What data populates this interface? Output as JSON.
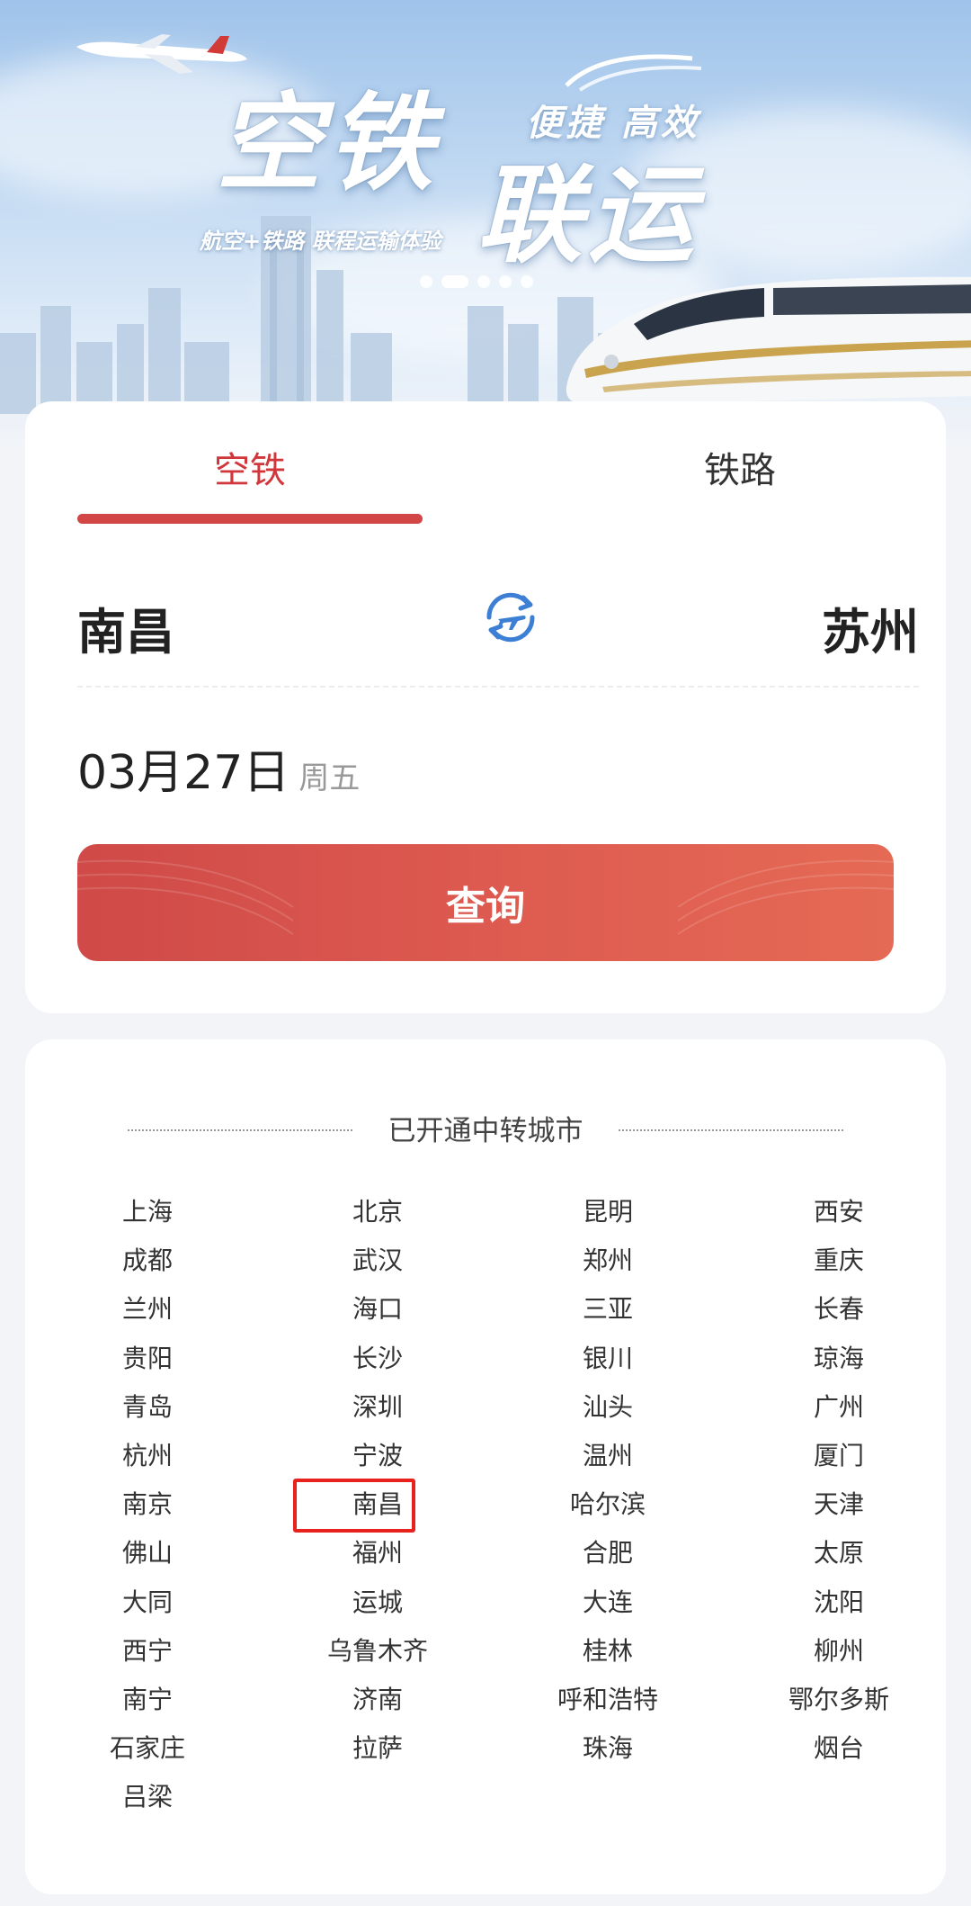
{
  "banner": {
    "title_line1": "空铁",
    "title_line2": "联运",
    "slogan": "便捷 高效",
    "subtitle": "航空+铁路 联程运输体验",
    "carousel_active_index": 1,
    "carousel_count": 5
  },
  "search": {
    "tabs": [
      {
        "label": "空铁",
        "active": true
      },
      {
        "label": "铁路",
        "active": false
      }
    ],
    "from_city": "南昌",
    "to_city": "苏州",
    "date": "03月27日",
    "weekday": "周五",
    "query_label": "查询",
    "accent_color": "#d0363a"
  },
  "cities": {
    "title": "已开通中转城市",
    "rows": [
      [
        "上海",
        "北京",
        "昆明",
        "西安"
      ],
      [
        "成都",
        "武汉",
        "郑州",
        "重庆"
      ],
      [
        "兰州",
        "海口",
        "三亚",
        "长春"
      ],
      [
        "贵阳",
        "长沙",
        "银川",
        "琼海"
      ],
      [
        "青岛",
        "深圳",
        "汕头",
        "广州"
      ],
      [
        "杭州",
        "宁波",
        "温州",
        "厦门"
      ],
      [
        "南京",
        "南昌",
        "哈尔滨",
        "天津"
      ],
      [
        "佛山",
        "福州",
        "合肥",
        "太原"
      ],
      [
        "大同",
        "运城",
        "大连",
        "沈阳"
      ],
      [
        "西宁",
        "乌鲁木齐",
        "桂林",
        "柳州"
      ],
      [
        "南宁",
        "济南",
        "呼和浩特",
        "鄂尔多斯"
      ],
      [
        "石家庄",
        "拉萨",
        "珠海",
        "烟台"
      ],
      [
        "吕梁"
      ]
    ],
    "highlighted_city": "南昌",
    "highlight_color": "#e8231d"
  }
}
